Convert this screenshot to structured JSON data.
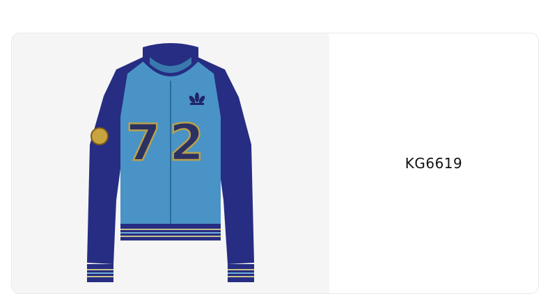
{
  "product": {
    "sku": "KG6619",
    "jacket_number": "72",
    "colors": {
      "body": "#4a93c6",
      "sleeve": "#262d82",
      "trim_stripe": "#c9c389",
      "number_outline": "#b9a24a",
      "number_fill": "#2b3163"
    },
    "icon": "adidas-trefoil-logo"
  }
}
